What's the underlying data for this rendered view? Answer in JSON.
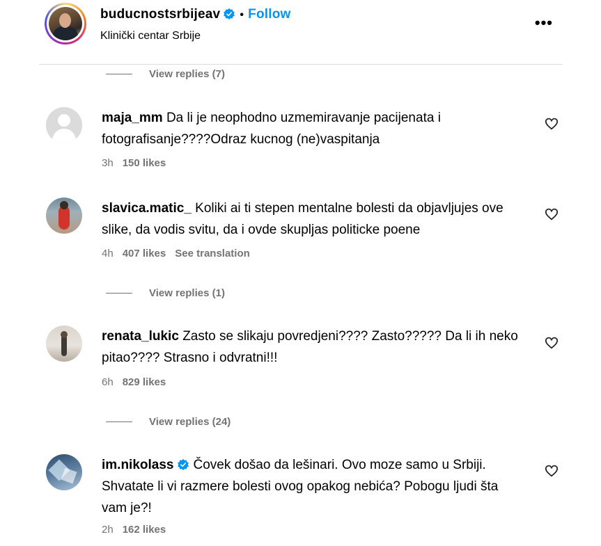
{
  "header": {
    "username": "buducnostsrbijeav",
    "separator": "•",
    "follow_label": "Follow",
    "location": "Klinički centar Srbije",
    "more_label": "•••"
  },
  "replies": [
    {
      "label": "View replies (7)"
    },
    {
      "label": "View replies (1)"
    },
    {
      "label": "View replies (24)"
    }
  ],
  "comments": [
    {
      "username": "maja_mm",
      "text": "Da li je neophodno uzmemiravanje pacijenata i fotografisanje????Odraz kucnog (ne)vaspitanja",
      "time": "3h",
      "likes": "150 likes"
    },
    {
      "username": "slavica.matic_",
      "text": "Koliki ai ti stepen mentalne bolesti da objavljujes ove slike, da vodis svitu, da i ovde skupljas politicke poene",
      "time": "4h",
      "likes": "407 likes",
      "translate": "See translation"
    },
    {
      "username": "renata_lukic",
      "text": "Zasto se slikaju povredjeni???? Zasto????? Da li ih neko pitao???? Strasno i odvratni!!!",
      "time": "6h",
      "likes": "829 likes"
    },
    {
      "username": "im.nikolass",
      "text": "Čovek došao da lešinari. Ovo moze samo u Srbiji. Shvatate li vi razmere bolesti ovog opakog nebića? Pobogu ljudi šta vam je?!",
      "time": "2h",
      "likes": "162 likes"
    }
  ],
  "colors": {
    "follow": "#0095f6",
    "verified": "#0095f6",
    "muted": "#737373",
    "divider": "#dbdbdb"
  },
  "icons": [
    "verified-badge-icon",
    "more-options-icon",
    "heart-icon",
    "default-avatar-icon"
  ]
}
